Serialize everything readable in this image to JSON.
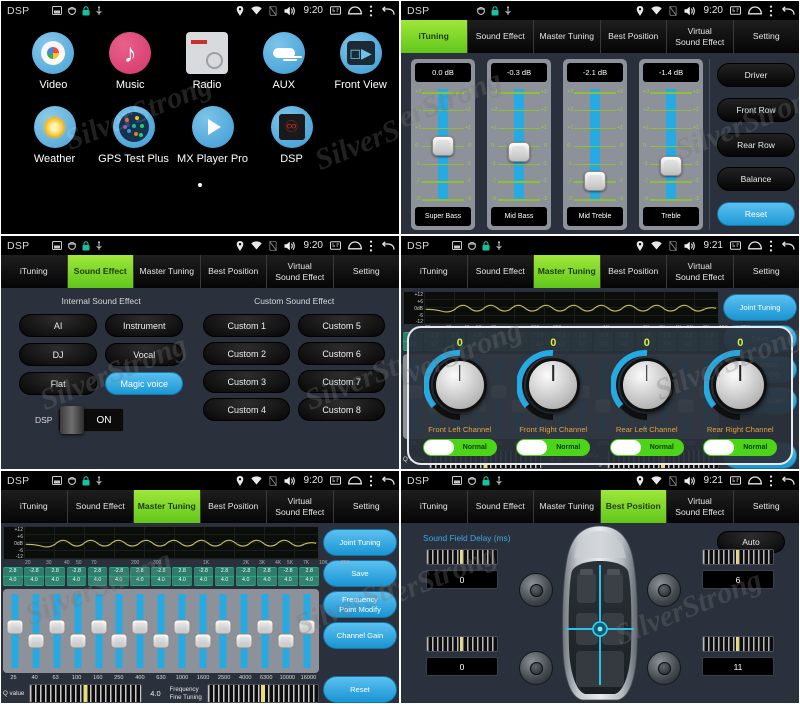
{
  "status_bar": {
    "app_title": "DSP",
    "time_920": "9:20",
    "time_921": "9:21",
    "left_icons": [
      "screen-icon",
      "dsp-icon",
      "lock-icon",
      "usb-icon"
    ],
    "right_icons": [
      "location-icon",
      "wifi-icon",
      "sim-off-icon",
      "volume-icon",
      "screenshot-icon",
      "home-icon",
      "menu-dots-icon",
      "back-icon"
    ]
  },
  "watermark": "SilverStrong",
  "home": {
    "apps_row1": [
      {
        "label": "Video",
        "icon": "video-icon"
      },
      {
        "label": "Music",
        "icon": "music-icon"
      },
      {
        "label": "Radio",
        "icon": "radio-icon"
      },
      {
        "label": "AUX",
        "icon": "aux-icon"
      },
      {
        "label": "Front View",
        "icon": "front-view-icon"
      }
    ],
    "apps_row2": [
      {
        "label": "Weather",
        "icon": "weather-icon"
      },
      {
        "label": "GPS Test Plus",
        "icon": "gps-icon"
      },
      {
        "label": "MX Player Pro",
        "icon": "mx-player-icon"
      },
      {
        "label": "DSP",
        "icon": "dsp-app-icon"
      }
    ]
  },
  "tabs": [
    {
      "label": "iTuning"
    },
    {
      "label": "Sound Effect"
    },
    {
      "label": "Master Tuning"
    },
    {
      "label": "Best Position"
    },
    {
      "label": "Virtual\nSound Effect",
      "line1": "Virtual",
      "line2": "Sound Effect"
    },
    {
      "label": "Setting"
    }
  ],
  "ituning": {
    "sliders": [
      {
        "value": "0.0 dB",
        "name": "Super Bass",
        "pos_pct": 50
      },
      {
        "value": "-0.3 dB",
        "name": "Mid Bass",
        "pos_pct": 55
      },
      {
        "value": "-2.1 dB",
        "name": "Mid Treble",
        "pos_pct": 80
      },
      {
        "value": "-1.4 dB",
        "name": "Treble",
        "pos_pct": 68
      }
    ],
    "tick_labels": [
      "+3",
      "+2",
      "+1",
      "0",
      "-1",
      "-2",
      "-3"
    ],
    "buttons": [
      "Driver",
      "Front Row",
      "Rear Row",
      "Balance"
    ],
    "reset_label": "Reset"
  },
  "sound_effect": {
    "internal_header": "Internal Sound Effect",
    "custom_header": "Custom Sound Effect",
    "internal": [
      "AI",
      "Instrument",
      "DJ",
      "Vocal",
      "Flat",
      "Magic voice"
    ],
    "internal_active": "Magic voice",
    "custom": [
      "Custom 1",
      "Custom 5",
      "Custom 2",
      "Custom 6",
      "Custom 3",
      "Custom 7",
      "Custom 4",
      "Custom 8"
    ],
    "dsp_switch_label": "DSP",
    "dsp_switch_state": "ON"
  },
  "master_tuning": {
    "y_axis": [
      "+12",
      "+6",
      "0dB",
      "-6",
      "-12"
    ],
    "graph_freq_labels": [
      "20",
      "30",
      "40",
      "50",
      "70",
      "200",
      "300",
      "1K",
      "2K",
      "3K",
      "4K",
      "5K",
      "7K",
      "10K",
      "20K"
    ],
    "buttons": [
      "Joint Tuning",
      "Save",
      "Frequency\nPoint Modify",
      "Channel Gain"
    ],
    "button_frequency_line1": "Frequency",
    "button_frequency_line2": "Point Modify",
    "reset_label": "Reset",
    "q_value_label": "Q value",
    "q_value": "4.0",
    "fine_tuning_label_line1": "Frequency",
    "fine_tuning_label_line2": "Fine Tuning",
    "bands": [
      {
        "freq": "25",
        "gain": "2.8",
        "q": "4.0",
        "knob_pct": 44,
        "knob2_pct": 0
      },
      {
        "freq": "40",
        "gain": "-2.8",
        "q": "4.0",
        "knob_pct": 0,
        "knob2_pct": 62
      },
      {
        "freq": "63",
        "gain": "2.8",
        "q": "4.0",
        "knob_pct": 44,
        "knob2_pct": 0
      },
      {
        "freq": "100",
        "gain": "-2.8",
        "q": "4.0",
        "knob_pct": 0,
        "knob2_pct": 62
      },
      {
        "freq": "160",
        "gain": "2.8",
        "q": "4.0",
        "knob_pct": 44,
        "knob2_pct": 0
      },
      {
        "freq": "250",
        "gain": "-2.8",
        "q": "4.0",
        "knob_pct": 0,
        "knob2_pct": 62
      },
      {
        "freq": "400",
        "gain": "2.8",
        "q": "4.0",
        "knob_pct": 44,
        "knob2_pct": 0
      },
      {
        "freq": "630",
        "gain": "-2.8",
        "q": "4.0",
        "knob_pct": 0,
        "knob2_pct": 62
      },
      {
        "freq": "1000",
        "gain": "2.8",
        "q": "4.0",
        "knob_pct": 44,
        "knob2_pct": 0
      },
      {
        "freq": "1600",
        "gain": "-2.8",
        "q": "4.0",
        "knob_pct": 0,
        "knob2_pct": 62
      },
      {
        "freq": "2500",
        "gain": "2.8",
        "q": "4.0",
        "knob_pct": 44,
        "knob2_pct": 0
      },
      {
        "freq": "4000",
        "gain": "-2.8",
        "q": "4.0",
        "knob_pct": 0,
        "knob2_pct": 62
      },
      {
        "freq": "6300",
        "gain": "2.8",
        "q": "4.0",
        "knob_pct": 44,
        "knob2_pct": 0
      },
      {
        "freq": "10000",
        "gain": "-2.8",
        "q": "4.0",
        "knob_pct": 0,
        "knob2_pct": 62
      },
      {
        "freq": "16000",
        "gain": "2.8",
        "q": "4.0",
        "knob_pct": 44,
        "knob2_pct": 0
      }
    ]
  },
  "channel_gain": {
    "channels": [
      {
        "name": "Front Left Channel",
        "value": "0",
        "mode": "Normal"
      },
      {
        "name": "Front Right Channel",
        "value": "0",
        "mode": "Normal"
      },
      {
        "name": "Rear Left Channel",
        "value": "0",
        "mode": "Normal"
      },
      {
        "name": "Rear Right Channel",
        "value": "0",
        "mode": "Normal"
      }
    ]
  },
  "best_position": {
    "title": "Sound Field Delay (ms)",
    "auto_label": "Auto",
    "delays": [
      {
        "position": "front-left",
        "value": "0",
        "marker_pct": 48
      },
      {
        "position": "front-right",
        "value": "6",
        "marker_pct": 62
      },
      {
        "position": "rear-left",
        "value": "0",
        "marker_pct": 48
      },
      {
        "position": "rear-right",
        "value": "11",
        "marker_pct": 74
      }
    ]
  },
  "colors": {
    "accent_green": "#7ed321",
    "accent_blue": "#27a9e1",
    "eq_teal": "#1dae86",
    "knob_yellow": "#d8ef3d",
    "channel_orange": "#e6a23c",
    "panel_bg": "#2b313c"
  }
}
